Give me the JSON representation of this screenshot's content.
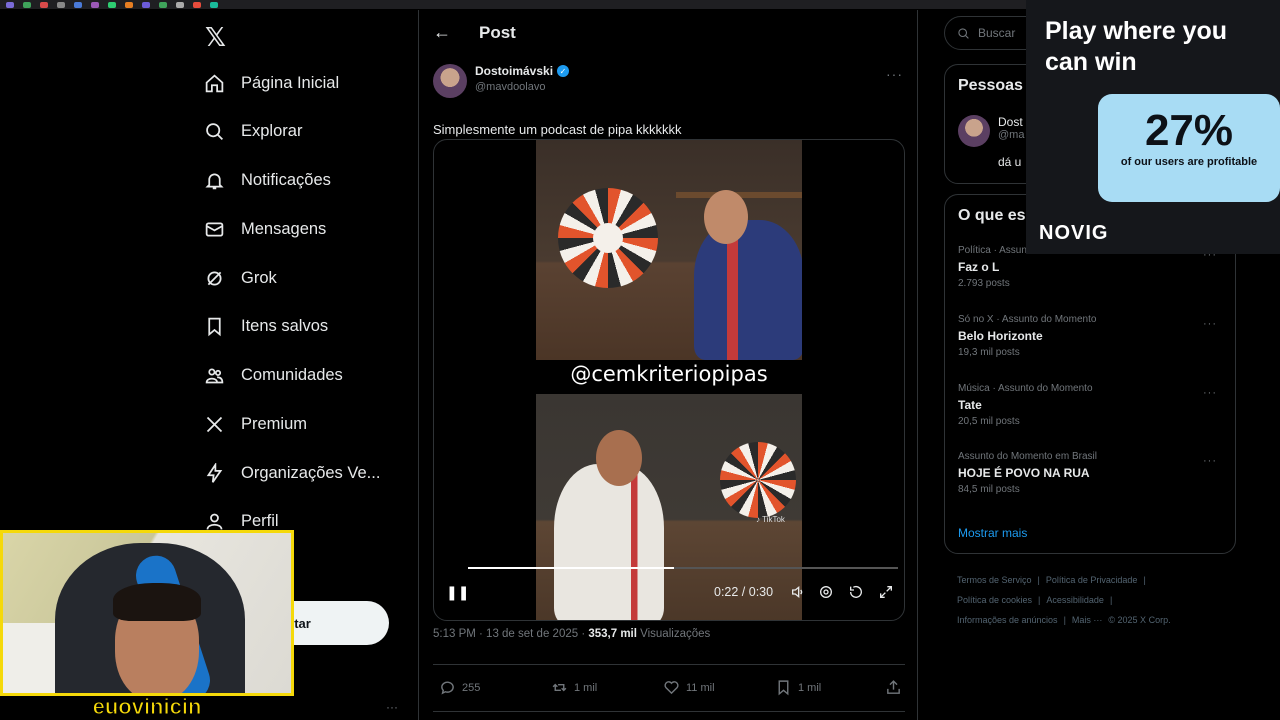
{
  "nav": {
    "logo": "𝕏",
    "items": [
      {
        "label": "Página Inicial",
        "icon": "home-icon"
      },
      {
        "label": "Explorar",
        "icon": "search-icon"
      },
      {
        "label": "Notificações",
        "icon": "bell-icon"
      },
      {
        "label": "Mensagens",
        "icon": "mail-icon"
      },
      {
        "label": "Grok",
        "icon": "grok-icon"
      },
      {
        "label": "Itens salvos",
        "icon": "bookmark-icon"
      },
      {
        "label": "Comunidades",
        "icon": "people-icon"
      },
      {
        "label": "Premium",
        "icon": "x-logo-icon"
      },
      {
        "label": "Organizações Ve...",
        "icon": "lightning-icon"
      },
      {
        "label": "Perfil",
        "icon": "person-icon"
      }
    ],
    "post_button": "star"
  },
  "post": {
    "header_title": "Post",
    "back_icon": "←",
    "author_name": "Dostoimávski",
    "author_handle": "@mavdoolavo",
    "more_icon": "···",
    "text": "Simplesmente um podcast de pipa kkkkkkk",
    "video": {
      "overlay_handle": "@cemkriteriopipas",
      "tiktok_tag": "♪ TikTok",
      "time": "0:22 / 0:30",
      "progress": 0.48,
      "pause_icon": "❚❚"
    },
    "timestamp": "5:13 PM · 13 de set de 2025 · ",
    "views_count": "353,7 mil",
    "views_label": " Visualizações",
    "actions": {
      "replies": "255",
      "reposts": "1 mil",
      "likes": "11 mil",
      "bookmarks": "1 mil"
    }
  },
  "sidebar": {
    "search_placeholder": "Buscar",
    "who_title": "Pessoas",
    "who_user_name": "Dost",
    "who_user_handle": "@ma",
    "who_user_bio": "dá u",
    "trends_title": "O que es",
    "trends": [
      {
        "category": "Política · Assunto do Momento",
        "title": "Faz o L",
        "count": "2.793 posts"
      },
      {
        "category": "Só no X · Assunto do Momento",
        "title": "Belo Horizonte",
        "count": "19,3 mil posts"
      },
      {
        "category": "Música · Assunto do Momento",
        "title": "Tate",
        "count": "20,5 mil posts"
      },
      {
        "category": "Assunto do Momento em Brasil",
        "title": "HOJE É POVO NA RUA",
        "count": "84,5 mil posts"
      }
    ],
    "show_more": "Mostrar mais",
    "footer": [
      "Termos de Serviço",
      "|",
      "Política de Privacidade",
      "|",
      "Política de cookies",
      "|",
      "Acessibilidade",
      "|",
      "Informações de anúncios",
      "|",
      "Mais ···",
      "© 2025 X Corp."
    ]
  },
  "ad": {
    "headline": "Play where you can win",
    "percent": "27%",
    "subtext": "of our users are profitable",
    "brand": "NOVIG"
  },
  "webcam": {
    "streamer_name": "euovinicin"
  },
  "colors": {
    "accent": "#1d9bf0",
    "background": "#000000",
    "border": "#2f3336",
    "ad_box": "#a8dcf4",
    "webcam_frame": "#f5d90a"
  }
}
